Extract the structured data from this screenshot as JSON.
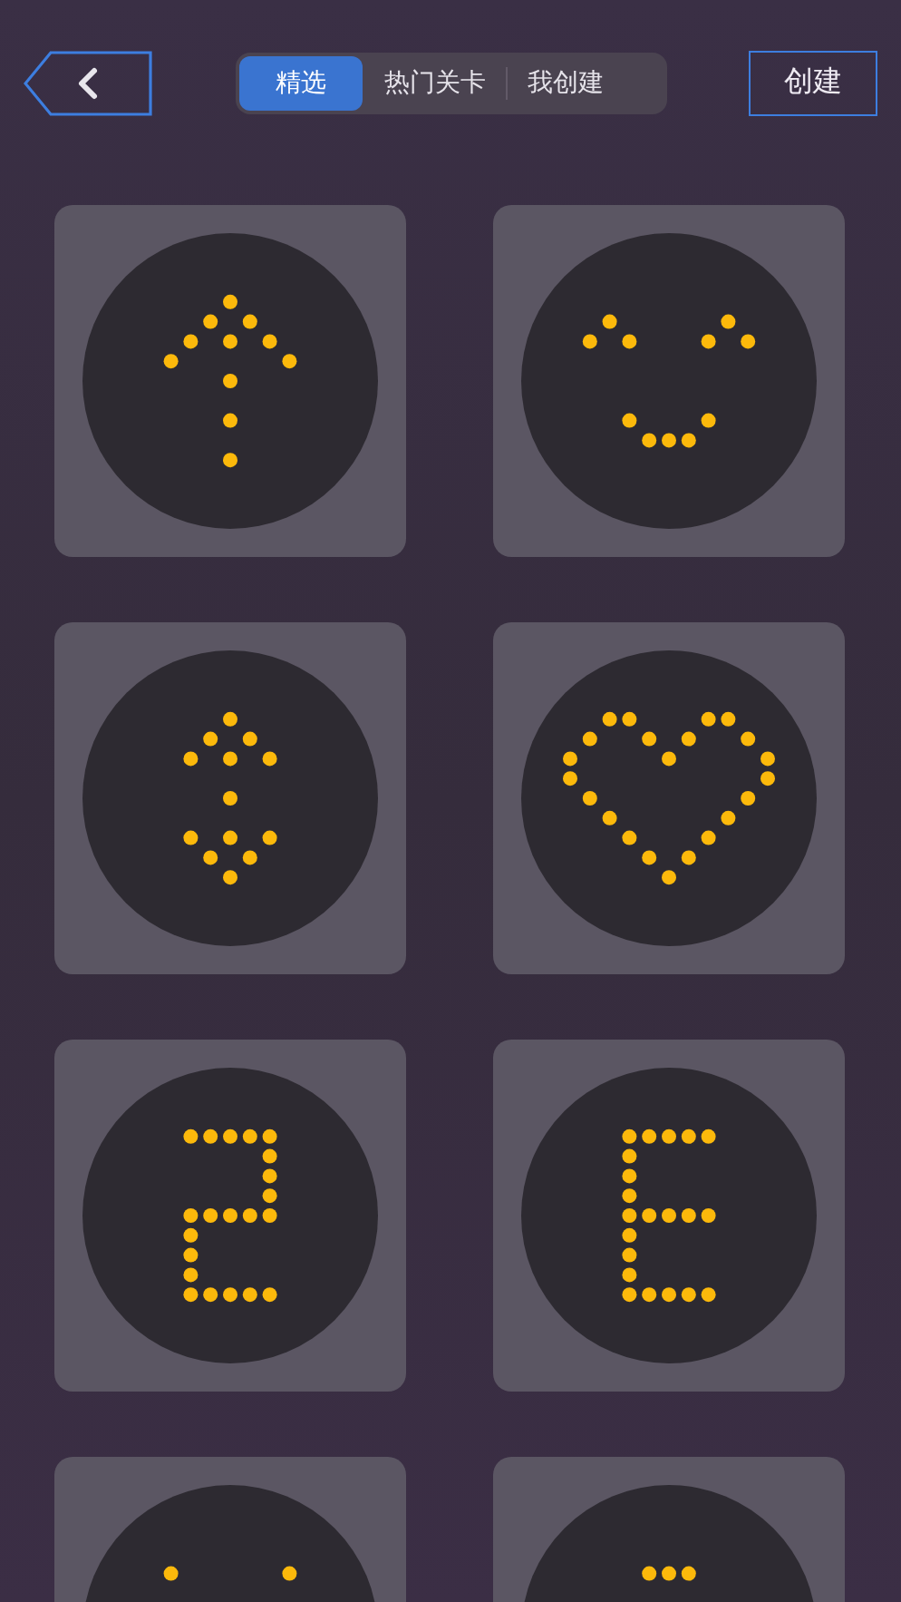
{
  "tabs": [
    {
      "label": "精选",
      "selected": true
    },
    {
      "label": "热门关卡",
      "selected": false
    },
    {
      "label": "我创建",
      "selected": false
    }
  ],
  "create_button": {
    "label": "创建"
  },
  "levels": [
    {
      "kind": "arrow-up"
    },
    {
      "kind": "smile"
    },
    {
      "kind": "double-arrow"
    },
    {
      "kind": "heart"
    },
    {
      "kind": "digit-two"
    },
    {
      "kind": "letter-e"
    },
    {
      "kind": "partial-wide"
    },
    {
      "kind": "partial-dash"
    }
  ]
}
